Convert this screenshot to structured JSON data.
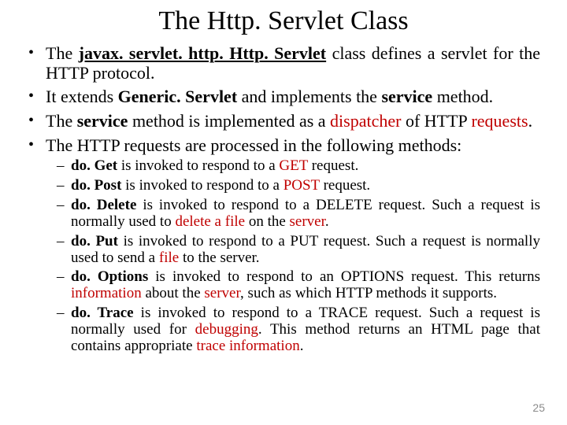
{
  "title": "The Http. Servlet Class",
  "page_number": "25",
  "b1": {
    "pre": "The ",
    "em": "javax. servlet. http. Http. Servlet",
    "post": " class defines a servlet for the HTTP protocol."
  },
  "b2": {
    "pre": "It extends ",
    "em1": "Generic. Servlet",
    "mid": " and implements the ",
    "em2": "service",
    "post": " method."
  },
  "b3": {
    "pre": "The ",
    "em1": "service",
    "mid": " method is implemented as a ",
    "r1": "dispatcher",
    "mid2": " of HTTP ",
    "r2": "requests",
    "post": "."
  },
  "b4": "The HTTP requests are processed in the following methods:",
  "s1": {
    "m": "do. Get",
    "mid": " is invoked to respond to a ",
    "r": "GET",
    "post": " request."
  },
  "s2": {
    "m": "do. Post",
    "mid": " is invoked to respond to a ",
    "r": "POST",
    "post": " request."
  },
  "s3": {
    "m": "do. Delete",
    "mid": " is invoked to respond to a DELETE request. Such a request is normally used to ",
    "r1": "delete a file",
    "mid2": " on the ",
    "r2": "server",
    "post": "."
  },
  "s4": {
    "m": "do. Put",
    "mid": " is invoked to respond to a PUT request. Such a request is normally used to send a ",
    "r": "file",
    "post": " to the server."
  },
  "s5": {
    "m": "do. Options",
    "mid": " is invoked to respond to an OPTIONS request. This returns ",
    "r1": "information",
    "mid2": " about the ",
    "r2": "server",
    "post": ", such as which HTTP methods it supports."
  },
  "s6": {
    "m": "do. Trace",
    "mid": " is invoked to respond to a TRACE request. Such a request is normally used for ",
    "r1": "debugging",
    "mid2": ". This method returns an HTML page that contains appropriate ",
    "r2": "trace information",
    "post": "."
  }
}
